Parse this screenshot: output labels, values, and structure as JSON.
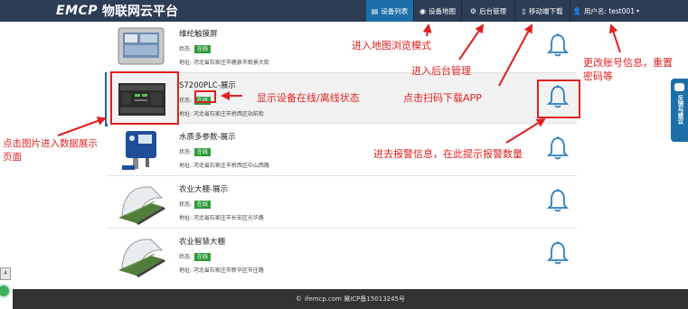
{
  "header": {
    "logo_mark": "EMCP",
    "logo_text": "物联网云平台",
    "nav": [
      {
        "label": "设备列表",
        "icon": "list-icon"
      },
      {
        "label": "设备地图",
        "icon": "globe-icon"
      },
      {
        "label": "后台管理",
        "icon": "gears-icon"
      },
      {
        "label": "移动端下载",
        "icon": "mobile-icon"
      },
      {
        "label": "用户名: test001",
        "icon": "user-icon"
      }
    ]
  },
  "devices": [
    {
      "name": "维纶触摸屏",
      "status_label": "状态:",
      "status": "在线",
      "address": "地址: 河北省石家庄市鹿泉市观景大街"
    },
    {
      "name": "S7200PLC-展示",
      "status_label": "状态:",
      "status": "在线",
      "address": "地址: 河北省石家庄市桥西区站前街"
    },
    {
      "name": "水质多参数-展示",
      "status_label": "状态:",
      "status": "在线",
      "address": "地址: 河北省石家庄市桥西区中山西路"
    },
    {
      "name": "农业大棚-展示",
      "status_label": "状态:",
      "status": "在线",
      "address": "地址: 河北省石家庄市长安区光华路"
    },
    {
      "name": "农业智慧大棚",
      "status_label": "状态:",
      "status": "在线",
      "address": "地址: 河北省石家庄市新华区市庄路"
    }
  ],
  "annotations": {
    "map": "进入地图浏览模式",
    "admin": "进入后台管理",
    "account": "更改账号信息，重置\n密码等",
    "status": "显示设备在线/离线状态",
    "app": "点击扫码下载APP",
    "image": "点击图片进入数据展示\n页面",
    "alarm": "进去报警信息，在此提示报警数量"
  },
  "feedback": {
    "label": "反馈与建议"
  },
  "footer": {
    "text": "ifemcp.com 冀ICP备15013245号"
  },
  "side_badge": "4"
}
